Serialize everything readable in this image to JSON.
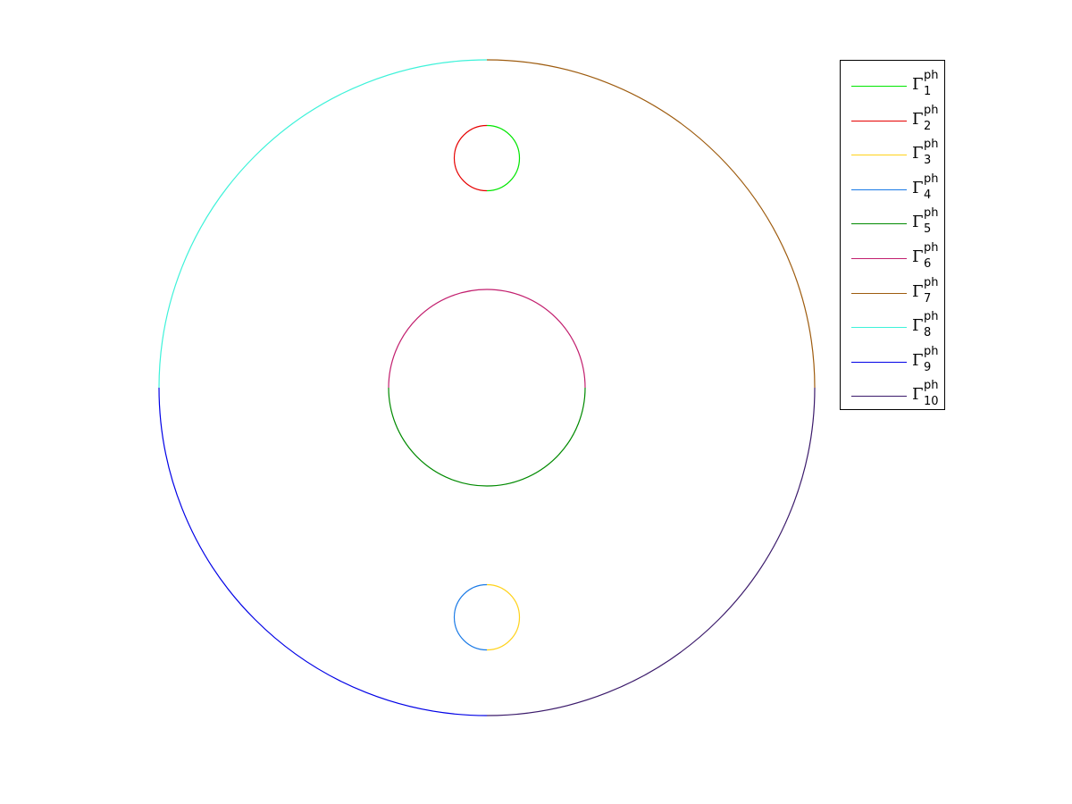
{
  "figure": {
    "background": "#ffffff",
    "symbol": "Γ",
    "superscript": "ph"
  },
  "boundaries": [
    {
      "index": "1",
      "color": "#00e600"
    },
    {
      "index": "2",
      "color": "#e60000"
    },
    {
      "index": "3",
      "color": "#ffd21a"
    },
    {
      "index": "4",
      "color": "#1a7ae6"
    },
    {
      "index": "5",
      "color": "#008a00"
    },
    {
      "index": "6",
      "color": "#c21f6e"
    },
    {
      "index": "7",
      "color": "#9e5c0f"
    },
    {
      "index": "8",
      "color": "#3df2d9"
    },
    {
      "index": "9",
      "color": "#0000e6"
    },
    {
      "index": "10",
      "color": "#3b1a6b"
    }
  ],
  "legend": {
    "placement": "top-right"
  }
}
